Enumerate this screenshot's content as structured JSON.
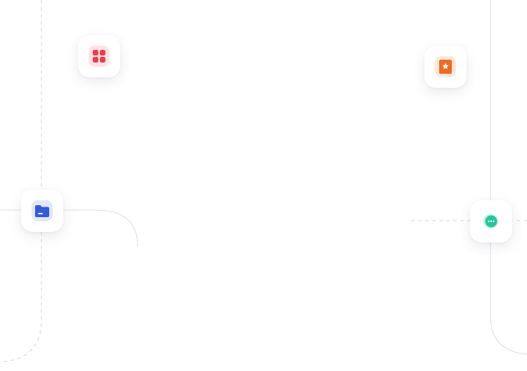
{
  "integrations": [
    {
      "id": "apps",
      "icon": "apps-grid-icon",
      "color": "#ef3b4a",
      "tint": "#fde3e4"
    },
    {
      "id": "bookmark",
      "icon": "star-bookmark-icon",
      "color": "#f26a22",
      "tint": "#ffe8d9"
    },
    {
      "id": "folder",
      "icon": "folder-icon",
      "color": "#2f5be0",
      "tint": "#e2e7fb"
    },
    {
      "id": "chat",
      "icon": "chat-bubble-icon",
      "color": "#22c79a",
      "tint": "#ffffff"
    }
  ],
  "connector_color": "#cfd3d9"
}
